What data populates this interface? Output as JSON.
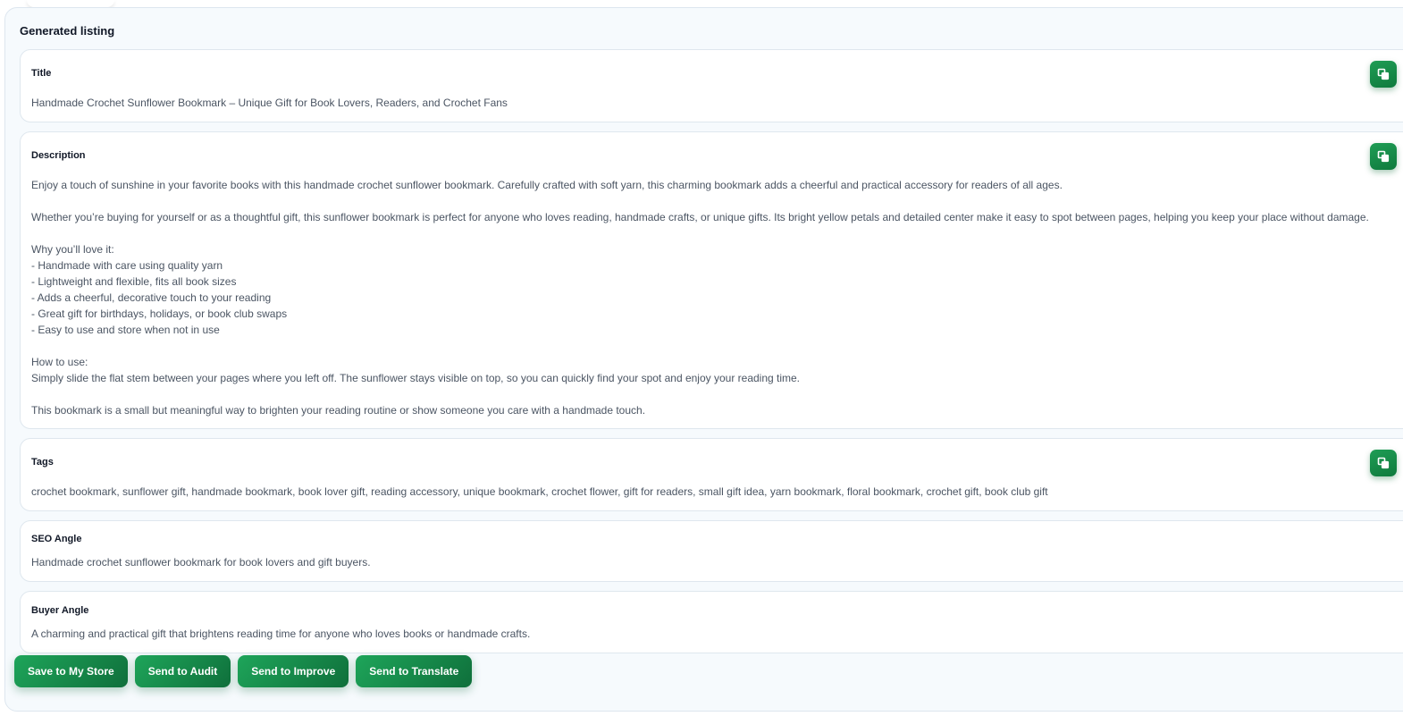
{
  "panel": {
    "heading": "Generated listing"
  },
  "title_card": {
    "label": "Title",
    "text": "Handmade Crochet Sunflower Bookmark – Unique Gift for Book Lovers, Readers, and Crochet Fans"
  },
  "description_card": {
    "label": "Description",
    "lines": [
      "Enjoy a touch of sunshine in your favorite books with this handmade crochet sunflower bookmark. Carefully crafted with soft yarn, this charming bookmark adds a cheerful and practical accessory for readers of all ages.",
      "",
      "Whether you’re buying for yourself or as a thoughtful gift, this sunflower bookmark is perfect for anyone who loves reading, handmade crafts, or unique gifts. Its bright yellow petals and detailed center make it easy to spot between pages, helping you keep your place without damage.",
      "",
      "Why you’ll love it:",
      "- Handmade with care using quality yarn",
      "- Lightweight and flexible, fits all book sizes",
      "- Adds a cheerful, decorative touch to your reading",
      "- Great gift for birthdays, holidays, or book club swaps",
      "- Easy to use and store when not in use",
      "",
      "How to use:",
      "Simply slide the flat stem between your pages where you left off. The sunflower stays visible on top, so you can quickly find your spot and enjoy your reading time.",
      "",
      "This bookmark is a small but meaningful way to brighten your reading routine or show someone you care with a handmade touch."
    ]
  },
  "tags_card": {
    "label": "Tags",
    "text": "crochet bookmark, sunflower gift, handmade bookmark, book lover gift, reading accessory, unique bookmark, crochet flower, gift for readers, small gift idea, yarn bookmark, floral bookmark, crochet gift, book club gift"
  },
  "seo_card": {
    "label": "SEO Angle",
    "text": "Handmade crochet sunflower bookmark for book lovers and gift buyers."
  },
  "buyer_card": {
    "label": "Buyer Angle",
    "text": "A charming and practical gift that brightens reading time for anyone who loves books or handmade crafts."
  },
  "actions": {
    "save": "Save to My Store",
    "audit": "Send to Audit",
    "improve": "Send to Improve",
    "translate": "Send to Translate"
  },
  "icons": {
    "copy": "copy-icon"
  },
  "colors": {
    "accent": "#16934a",
    "accent_dark": "#0f6f3b",
    "panel_bg": "#f6fafd"
  }
}
